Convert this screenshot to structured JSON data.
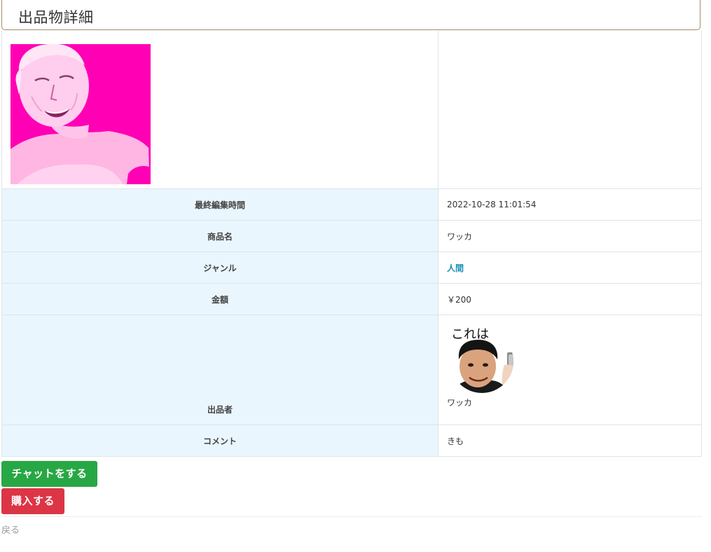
{
  "page_title": "出品物詳細",
  "product_image": {
    "icon": "product-photo",
    "background_color": "#ff00b4"
  },
  "rows": {
    "last_edited": {
      "label": "最終編集時間",
      "value": "2022-10-28 11:01:54"
    },
    "product_name": {
      "label": "商品名",
      "value": "ワッカ"
    },
    "genre": {
      "label": "ジャンル",
      "value": "人間"
    },
    "price": {
      "label": "金額",
      "value": "￥200"
    },
    "seller": {
      "label": "出品者",
      "name": "ワッカ",
      "avatar_caption": "これは"
    },
    "comment": {
      "label": "コメント",
      "value": "きも"
    }
  },
  "buttons": {
    "chat": "チャットをする",
    "buy": "購入する"
  },
  "back_link": "戻る",
  "colors": {
    "label_bg": "#e9f6fd",
    "chat_button": "#28a745",
    "buy_button": "#dc3545",
    "genre_link": "#1b8fb8",
    "title_border": "#a58a66"
  }
}
